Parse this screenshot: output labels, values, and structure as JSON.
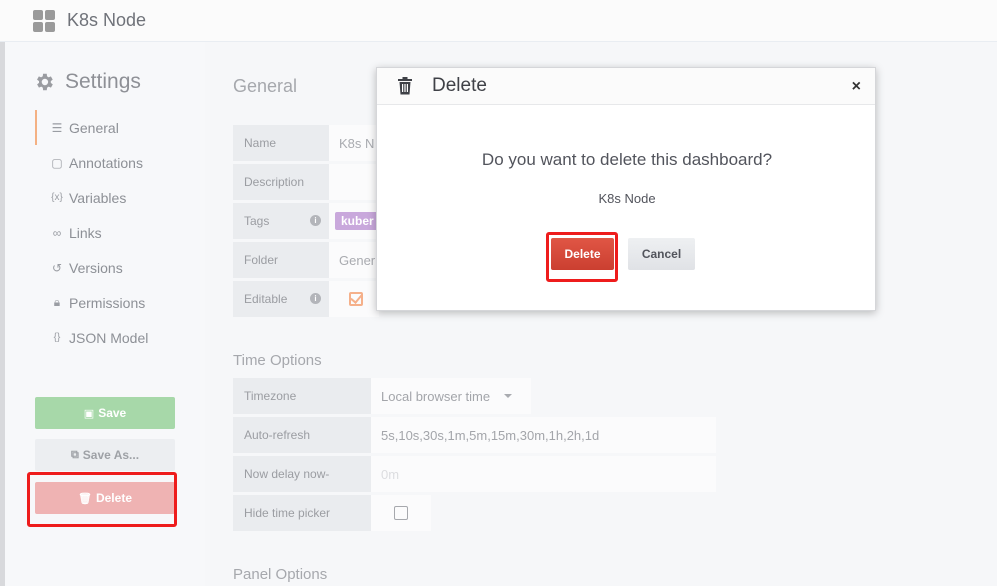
{
  "header": {
    "title": "K8s Node"
  },
  "sidebar": {
    "title": "Settings",
    "items": [
      {
        "label": "General",
        "icon": "sliders-icon",
        "active": true
      },
      {
        "label": "Annotations",
        "icon": "comment-icon"
      },
      {
        "label": "Variables",
        "icon": "variable-icon"
      },
      {
        "label": "Links",
        "icon": "link-icon"
      },
      {
        "label": "Versions",
        "icon": "history-icon"
      },
      {
        "label": "Permissions",
        "icon": "lock-icon"
      },
      {
        "label": "JSON Model",
        "icon": "json-icon"
      }
    ],
    "save_label": "Save",
    "save_as_label": "Save As...",
    "delete_label": "Delete"
  },
  "general": {
    "title": "General",
    "name_label": "Name",
    "name_value": "K8s N",
    "description_label": "Description",
    "tags_label": "Tags",
    "tag_chip": "kuber",
    "folder_label": "Folder",
    "folder_value": "Gener",
    "editable_label": "Editable"
  },
  "time_options": {
    "title": "Time Options",
    "timezone_label": "Timezone",
    "timezone_value": "Local browser time",
    "autorefresh_label": "Auto-refresh",
    "autorefresh_value": "5s,10s,30s,1m,5m,15m,30m,1h,2h,1d",
    "nowdelay_label": "Now delay now-",
    "nowdelay_placeholder": "0m",
    "hidetime_label": "Hide time picker"
  },
  "panel_options": {
    "title": "Panel Options"
  },
  "modal": {
    "title": "Delete",
    "question": "Do you want to delete this dashboard?",
    "dashboard_name": "K8s Node",
    "delete_label": "Delete",
    "cancel_label": "Cancel",
    "close_glyph": "×"
  },
  "colors": {
    "danger": "#d44a3a",
    "success": "#a7d8a9",
    "highlight": "#ee1c1c",
    "tag": "#c9a8dc"
  }
}
